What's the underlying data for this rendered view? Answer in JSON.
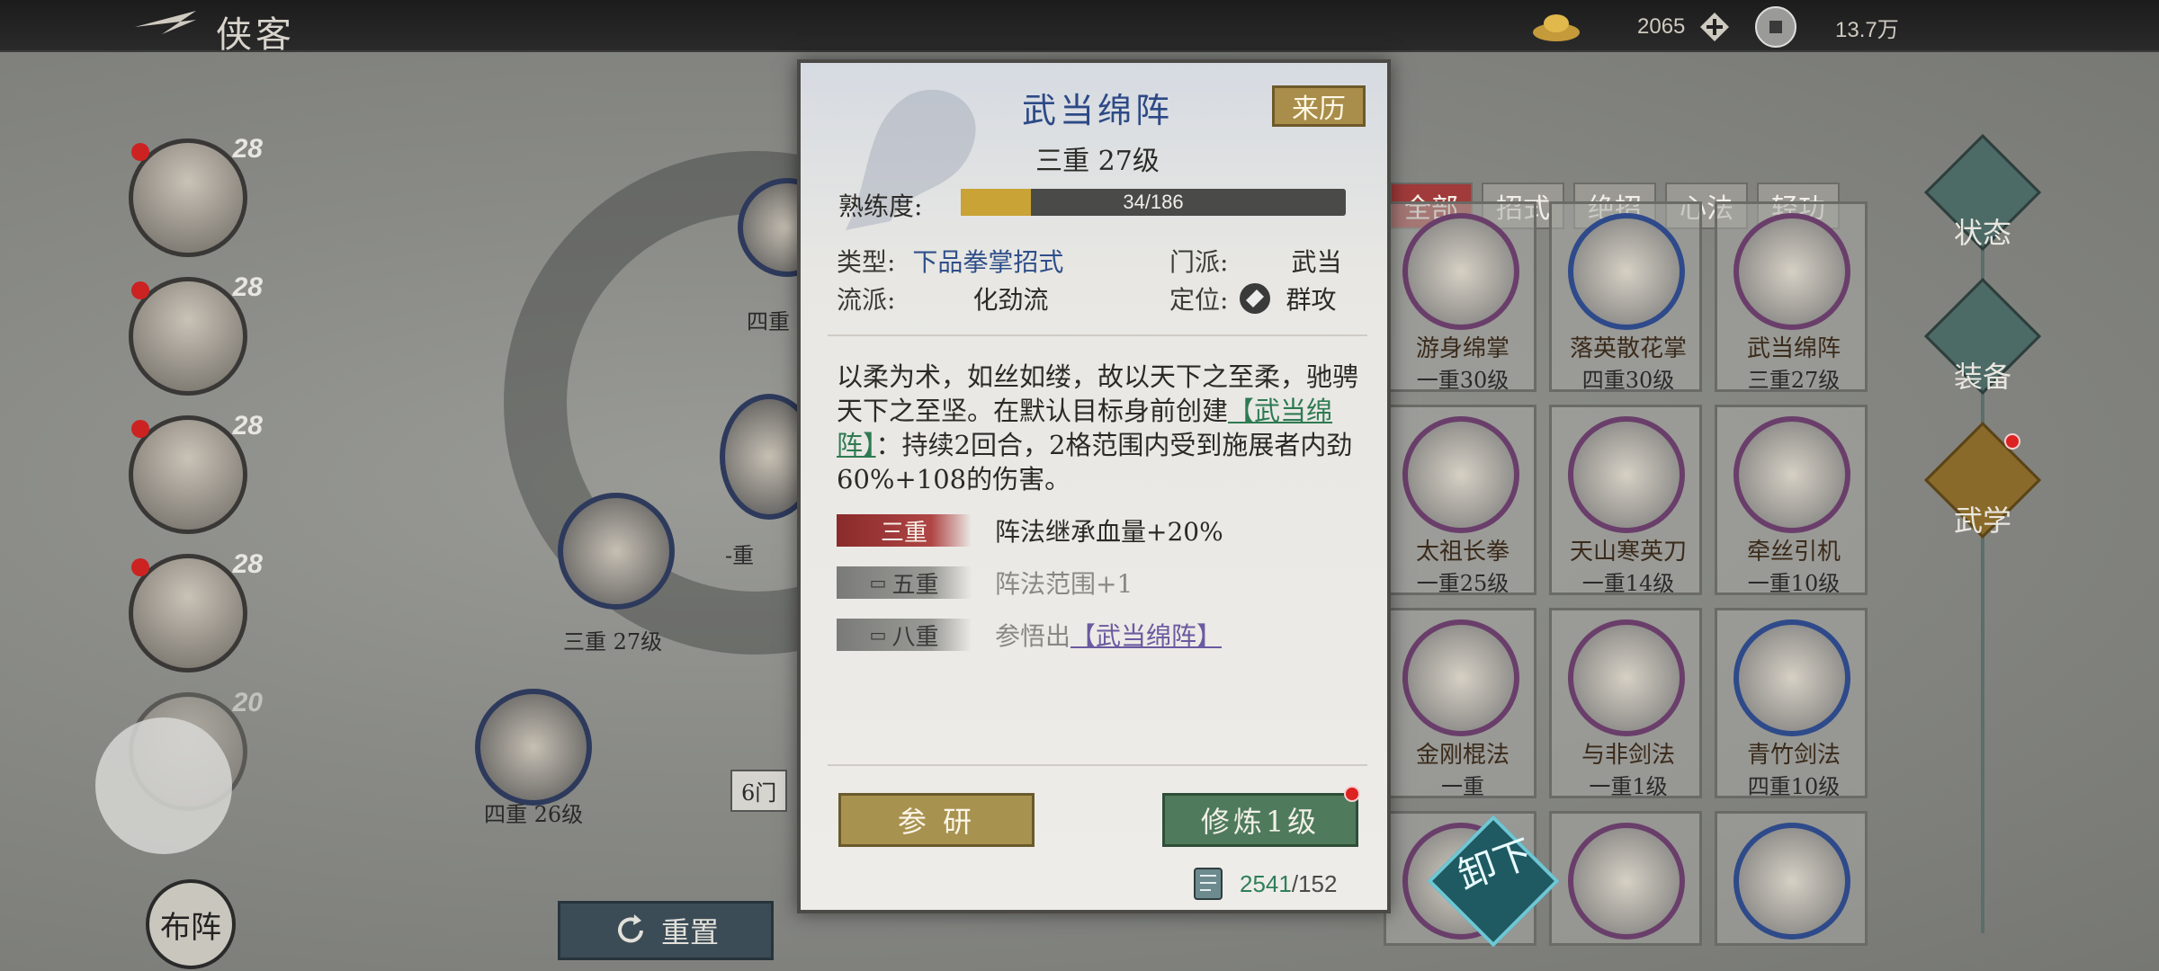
{
  "header": {
    "title": "侠客",
    "currency1": "2065",
    "currency2": "13.7万"
  },
  "roster": [
    {
      "level": "28"
    },
    {
      "level": "28"
    },
    {
      "level": "28"
    },
    {
      "level": "28"
    },
    {
      "level": "20"
    }
  ],
  "nodes": [
    {
      "label": "三重 27级"
    },
    {
      "label": "四重 26级"
    },
    {
      "label": "四重"
    },
    {
      "label": "-重"
    },
    {
      "label": "6门"
    }
  ],
  "reset_label": "重置",
  "formation_label": "布阵",
  "tabs": [
    {
      "label": "全部"
    },
    {
      "label": "招式"
    },
    {
      "label": "绝招"
    },
    {
      "label": "心法"
    },
    {
      "label": "轻功"
    }
  ],
  "cards": [
    {
      "name": "游身绵掌",
      "level": "一重30级"
    },
    {
      "name": "落英散花掌",
      "level": "四重30级"
    },
    {
      "name": "武当绵阵",
      "level": "三重27级"
    },
    {
      "name": "太祖长拳",
      "level": "一重25级"
    },
    {
      "name": "天山寒英刀",
      "level": "一重14级"
    },
    {
      "name": "牵丝引机",
      "level": "一重10级"
    },
    {
      "name": "金刚棍法",
      "level": "一重"
    },
    {
      "name": "与非剑法",
      "level": "一重1级"
    },
    {
      "name": "青竹剑法",
      "level": "四重10级"
    }
  ],
  "right_menu": [
    {
      "label": "状态"
    },
    {
      "label": "装备"
    },
    {
      "label": "武学"
    }
  ],
  "unload_label": "卸下",
  "detail": {
    "name": "武当绵阵",
    "origin_label": "来历",
    "rank": "三重 27级",
    "proficiency_label": "熟练度:",
    "proficiency_text": "34/186",
    "proficiency_value": 0.183,
    "type_key": "类型:",
    "type_val": "下品拳掌招式",
    "sect_key": "门派:",
    "sect_val": "武当",
    "school_key": "流派:",
    "school_val": "化劲流",
    "role_key": "定位:",
    "role_val": "群攻",
    "desc_a": "以柔为术，如丝如缕，故以天下之至柔，驰骋天下之至坚。在默认目标身前创建",
    "desc_link": "【武当绵阵】",
    "desc_b": "：持续2回合，2格范围内受到施展者内劲60%+108的伤害。",
    "tiers": [
      {
        "badge": "三重",
        "effect": "阵法继承血量+20%"
      },
      {
        "badge": "五重",
        "effect": "阵法范围+1"
      },
      {
        "badge": "八重",
        "effect_prefix": "参悟出",
        "effect_link": "【武当绵阵】"
      }
    ],
    "study_label": "参 研",
    "train_label": "修炼1级",
    "cost_have": "2541",
    "cost_need": "/152"
  }
}
